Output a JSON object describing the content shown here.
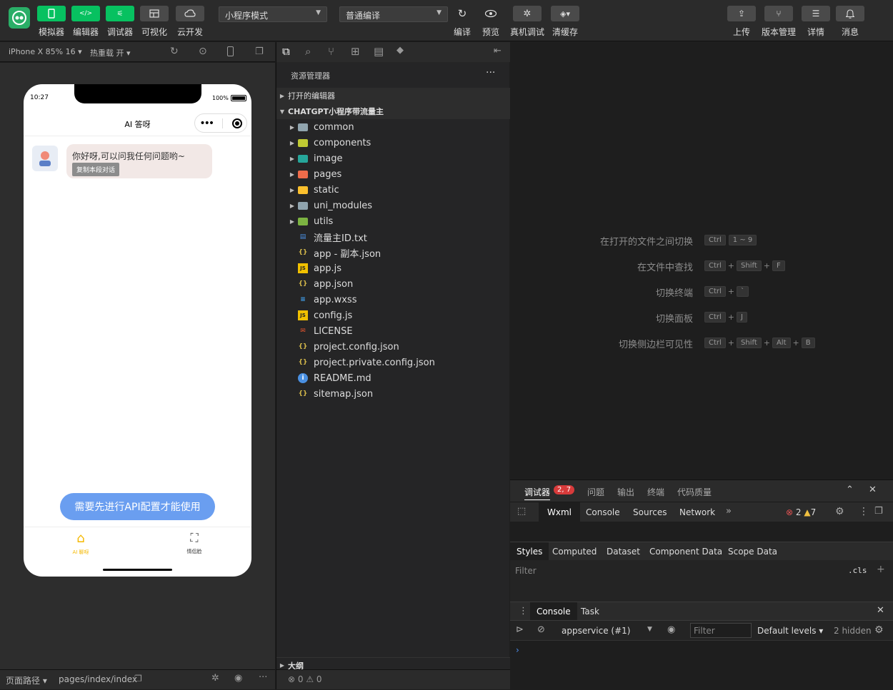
{
  "toolbar": {
    "buttons": [
      {
        "label": "模拟器",
        "active": true
      },
      {
        "label": "编辑器",
        "active": true
      },
      {
        "label": "调试器",
        "active": true
      },
      {
        "label": "可视化",
        "active": false
      },
      {
        "label": "云开发",
        "active": false
      }
    ],
    "mode_select": "小程序模式",
    "compile_select": "普通编译",
    "actions": [
      "编译",
      "预览",
      "真机调试",
      "清缓存"
    ],
    "right_actions": [
      "上传",
      "版本管理",
      "详情",
      "消息"
    ]
  },
  "simulator": {
    "device": "iPhone X 85% 16",
    "hot_reload": "热重载 开",
    "phone": {
      "time": "10:27",
      "battery": "100%",
      "nav_title": "AI 答呀",
      "message": "你好呀,可以问我任何问题哟~",
      "copy_label": "复制本段对话",
      "api_button": "需要先进行API配置才能使用",
      "tabs": [
        "AI 聊呀",
        "情侣脸"
      ]
    },
    "path_label": "页面路径",
    "path_value": "pages/index/index"
  },
  "explorer": {
    "title": "资源管理器",
    "more": "···",
    "open_editors": "打开的编辑器",
    "project": "CHATGPT小程序带流量主",
    "folders": [
      {
        "name": "common",
        "color": "#90a4ae"
      },
      {
        "name": "components",
        "color": "#c0ca33"
      },
      {
        "name": "image",
        "color": "#26a69a"
      },
      {
        "name": "pages",
        "color": "#ef6c4a"
      },
      {
        "name": "static",
        "color": "#fbc02d"
      },
      {
        "name": "uni_modules",
        "color": "#90a4ae"
      },
      {
        "name": "utils",
        "color": "#7cb342"
      }
    ],
    "files": [
      {
        "name": "流量主ID.txt",
        "icon": "txt-icon"
      },
      {
        "name": "app - 副本.json",
        "icon": "json-icon"
      },
      {
        "name": "app.js",
        "icon": "js-icon"
      },
      {
        "name": "app.json",
        "icon": "json-icon"
      },
      {
        "name": "app.wxss",
        "icon": "css-icon"
      },
      {
        "name": "config.js",
        "icon": "js-icon"
      },
      {
        "name": "LICENSE",
        "icon": "license-icon"
      },
      {
        "name": "project.config.json",
        "icon": "json-icon"
      },
      {
        "name": "project.private.config.json",
        "icon": "json-icon"
      },
      {
        "name": "README.md",
        "icon": "info-icon"
      },
      {
        "name": "sitemap.json",
        "icon": "json-icon"
      }
    ],
    "outline": "大纲",
    "errors": "0",
    "warnings": "0"
  },
  "shortcuts": [
    {
      "label": "在打开的文件之间切换",
      "keys": [
        "Ctrl",
        "1 ~ 9"
      ]
    },
    {
      "label": "在文件中查找",
      "keys": [
        "Ctrl",
        "+",
        "Shift",
        "+",
        "F"
      ]
    },
    {
      "label": "切换终端",
      "keys": [
        "Ctrl",
        "+",
        "`"
      ]
    },
    {
      "label": "切换面板",
      "keys": [
        "Ctrl",
        "+",
        "J"
      ]
    },
    {
      "label": "切换侧边栏可见性",
      "keys": [
        "Ctrl",
        "+",
        "Shift",
        "+",
        "Alt",
        "+",
        "B"
      ]
    }
  ],
  "debugger": {
    "tabs": [
      "调试器",
      "问题",
      "输出",
      "终端",
      "代码质量"
    ],
    "badge": "2, 7",
    "devtabs": [
      "Wxml",
      "Console",
      "Sources",
      "Network"
    ],
    "errors": "2",
    "warnings": "7",
    "style_tabs": [
      "Styles",
      "Computed",
      "Dataset",
      "Component Data",
      "Scope Data"
    ],
    "filter_placeholder": "Filter",
    "cls": ".cls",
    "console_tabs": [
      "Console",
      "Task"
    ],
    "context": "appservice (#1)",
    "filter2": "Filter",
    "levels": "Default levels",
    "hidden": "2 hidden"
  }
}
